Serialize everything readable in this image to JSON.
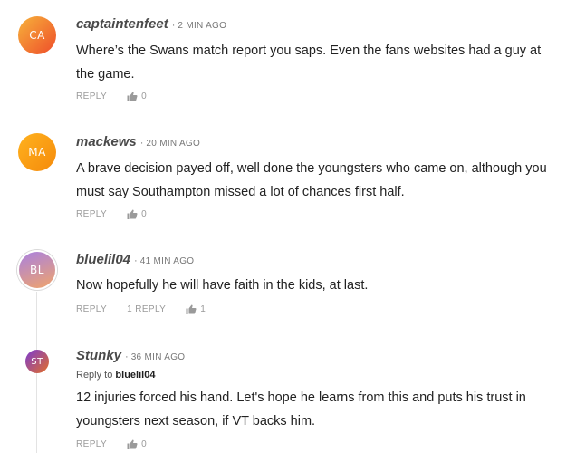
{
  "comments": [
    {
      "initials": "CA",
      "username": "captaintenfeet",
      "time": "2 MIN AGO",
      "text": "Where’s the Swans match report you saps. Even the fans websites had a guy at the game.",
      "reply_label": "REPLY",
      "likes": "0"
    },
    {
      "initials": "MA",
      "username": "mackews",
      "time": "20 MIN AGO",
      "text": "A brave decision payed off, well done the youngsters who came on, although you must say Southampton missed a lot of chances first half.",
      "reply_label": "REPLY",
      "likes": "0"
    },
    {
      "initials": "BL",
      "username": "bluelil04",
      "time": "41 MIN AGO",
      "text": "Now hopefully he will have faith in the kids, at last.",
      "reply_label": "REPLY",
      "replies_label": "1 REPLY",
      "likes": "1"
    },
    {
      "initials": "ST",
      "username": "Stunky",
      "time": "36 MIN AGO",
      "reply_to_prefix": "Reply to",
      "reply_to_user": "bluelil04",
      "text": "12 injuries forced his hand. Let's hope he learns from this and puts his trust in youngsters next season, if VT backs him.",
      "reply_label": "REPLY",
      "likes": "0"
    }
  ],
  "colors": {
    "avatar_ca": "#ee4d2a",
    "avatar_ma": "#f58a0b",
    "avatar_bl": "#a981e0",
    "avatar_st": "#7b3bd1",
    "meta_gray": "#9a9a9a"
  },
  "icons": {
    "like": "thumbs-up-icon"
  }
}
